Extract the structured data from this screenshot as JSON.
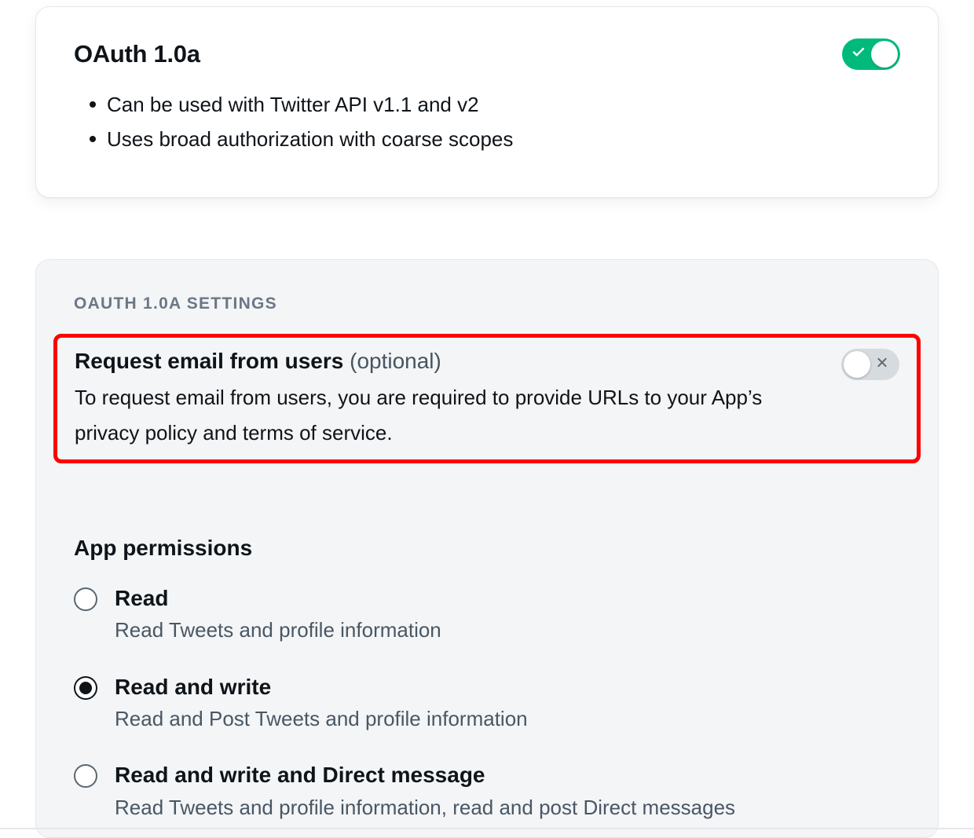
{
  "oauth_card": {
    "title": "OAuth 1.0a",
    "toggle_on": true,
    "bullets": [
      "Can be used with Twitter API v1.1 and v2",
      "Uses broad authorization with coarse scopes"
    ]
  },
  "settings_panel": {
    "label": "OAUTH 1.0A SETTINGS",
    "request_email": {
      "title_bold": "Request email from users",
      "title_light": "(optional)",
      "description": "To request email from users, you are required to provide URLs to your App’s privacy policy and terms of service.",
      "toggle_on": false
    },
    "app_permissions": {
      "title": "App permissions",
      "options": [
        {
          "label": "Read",
          "desc": "Read Tweets and profile information",
          "selected": false
        },
        {
          "label": "Read and write",
          "desc": "Read and Post Tweets and profile information",
          "selected": true
        },
        {
          "label": "Read and write and Direct message",
          "desc": "Read Tweets and profile information, read and post Direct messages",
          "selected": false
        }
      ]
    }
  }
}
